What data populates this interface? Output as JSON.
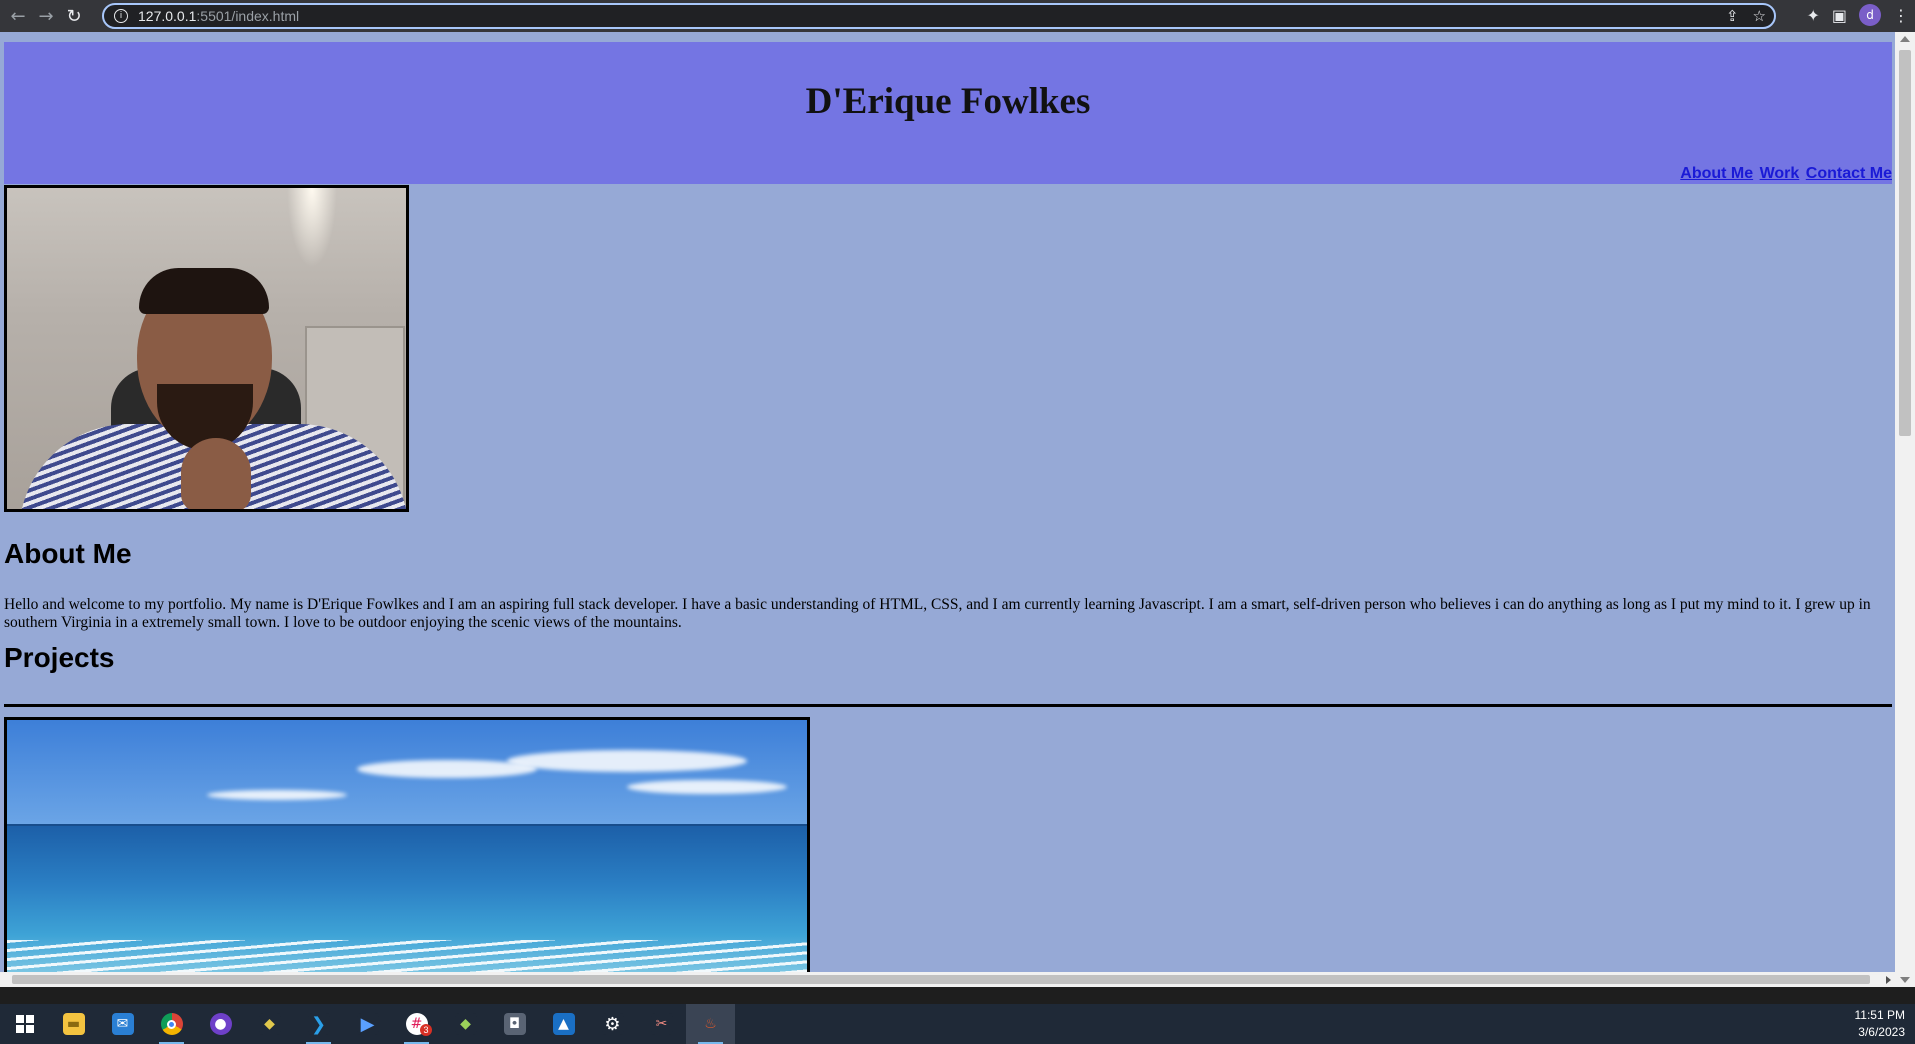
{
  "browser": {
    "url_host": "127.0.0.1",
    "url_path": ":5501/index.html",
    "profile_initial": "d"
  },
  "site": {
    "title": "D'Erique Fowlkes",
    "nav": [
      "About Me",
      "Work",
      "Contact Me"
    ],
    "about_heading": "About Me",
    "about_text": "Hello and welcome to my portfolio. My name is D'Erique Fowlkes and I am an aspiring full stack developer. I have a basic understanding of HTML, CSS, and I am currently learning Javascript. I am a smart, self-driven person who believes i can do anything as long as I put my mind to it. I grew up in southern Virginia in a extremely small town. I love to be outdoor enjoying the scenic views of the mountains.",
    "projects_heading": "Projects"
  },
  "colors": {
    "header_bg": "#7475e3",
    "page_bg": "#96a9d6",
    "link": "#1a1ad6"
  },
  "taskbar": {
    "icons": [
      "windows-start",
      "file-explorer",
      "mail",
      "chrome",
      "github-desktop",
      "git-kraken",
      "vscode",
      "bing",
      "slack",
      "sourcetree",
      "camera",
      "photos",
      "settings",
      "snipping-tool",
      "active-app"
    ],
    "slack_badge": "3",
    "time": "11:51 PM",
    "date": "3/6/2023"
  }
}
